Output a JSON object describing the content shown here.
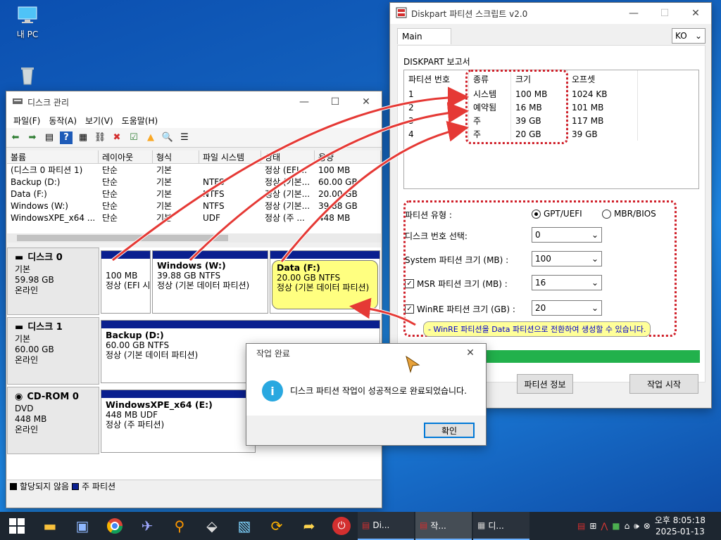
{
  "desktop": {
    "icons": [
      {
        "label": "내 PC"
      },
      {
        "label": ""
      }
    ]
  },
  "disk_mgmt": {
    "title": "디스크 관리",
    "menu": [
      "파일(F)",
      "동작(A)",
      "보기(V)",
      "도움말(H)"
    ],
    "columns": [
      "볼륨",
      "레이아웃",
      "형식",
      "파일 시스템",
      "상태",
      "용량"
    ],
    "volumes": [
      [
        "(디스크 0 파티션 1)",
        "단순",
        "기본",
        "",
        "정상 (EFI...",
        "100 MB"
      ],
      [
        "Backup (D:)",
        "단순",
        "기본",
        "NTFS",
        "정상 (기본...",
        "60.00 GB"
      ],
      [
        "Data (F:)",
        "단순",
        "기본",
        "NTFS",
        "정상 (기본...",
        "20.00 GB"
      ],
      [
        "Windows (W:)",
        "단순",
        "기본",
        "NTFS",
        "정상 (기본...",
        "39.88 GB"
      ],
      [
        "WindowsXPE_x64 ...",
        "단순",
        "기본",
        "UDF",
        "정상 (주 ...",
        "448 MB"
      ]
    ],
    "disks": [
      {
        "name": "디스크 0",
        "type": "기본",
        "size": "59.98 GB",
        "status": "온라인",
        "partitions": [
          {
            "title": "",
            "size": "100 MB",
            "state": "정상 (EFI 시"
          },
          {
            "title": "Windows   (W:)",
            "size": "39.88 GB NTFS",
            "state": "정상 (기본 데이터 파티션)"
          },
          {
            "title": "Data   (F:)",
            "size": "20.00 GB NTFS",
            "state": "정상 (기본 데이터 파티션)"
          }
        ]
      },
      {
        "name": "디스크 1",
        "type": "기본",
        "size": "60.00 GB",
        "status": "온라인",
        "partitions": [
          {
            "title": "Backup   (D:)",
            "size": "60.00 GB NTFS",
            "state": "정상 (기본 데이터 파티션)"
          }
        ]
      },
      {
        "name": "CD-ROM 0",
        "type": "DVD",
        "size": "448 MB",
        "status": "온라인",
        "partitions": [
          {
            "title": "WindowsXPE_x64   (E:)",
            "size": "448 MB UDF",
            "state": "정상 (주 파티션)"
          }
        ]
      }
    ],
    "legend": {
      "unallocated": "할당되지 않음",
      "primary": "주 파티션"
    }
  },
  "diskpart": {
    "title": "Diskpart 파티션 스크립트 v2.0",
    "tab": "Main",
    "lang": "KO",
    "report_title": "DISKPART 보고서",
    "report_cols": [
      "파티션 번호",
      "종류",
      "크기",
      "오프셋"
    ],
    "report_rows": [
      [
        "1",
        "시스템",
        "100 MB",
        "1024 KB"
      ],
      [
        "2",
        "예약됨",
        "16 MB",
        "101 MB"
      ],
      [
        "3",
        "주",
        "39 GB",
        "117 MB"
      ],
      [
        "4",
        "주",
        "20 GB",
        "39 GB"
      ]
    ],
    "partition_type_label": "파티션 유형 :",
    "gpt_label": "GPT/UEFI",
    "mbr_label": "MBR/BIOS",
    "disk_select_label": "디스크 번호 선택:",
    "disk_select_value": "0",
    "system_size_label": "System 파티션 크기 (MB) :",
    "system_size_value": "100",
    "msr_label": "MSR 파티션 크기 (MB) :",
    "msr_value": "16",
    "winre_label": "WinRE 파티션 크기 (GB) :",
    "winre_value": "20",
    "hint": "- WinRE 파티션을 Data 파티션으로 전환하여 생성할 수 있습니다.",
    "progress": 1.0,
    "info_button": "파티션 정보",
    "start_button": "작업 시작",
    "accent_red": "#d0202a",
    "progress_color": "#22b14c"
  },
  "msgbox": {
    "title": "작업 완료",
    "text": "디스크 파티션 작업이 성공적으로 완료되었습니다.",
    "ok": "확인"
  },
  "taskbar": {
    "tasks": [
      "Di...",
      "작...",
      "디..."
    ],
    "time": "오후 8:05:18",
    "date": "2025-01-13"
  }
}
